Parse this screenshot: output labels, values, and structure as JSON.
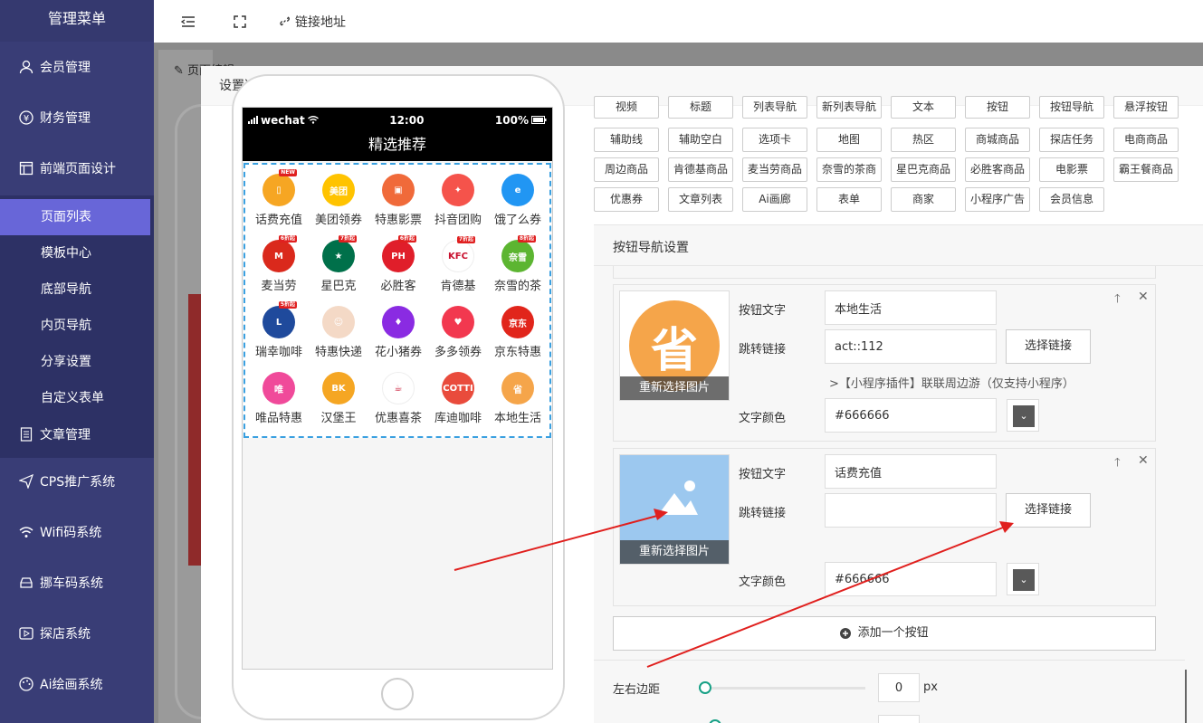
{
  "sidebar": {
    "title": "管理菜单",
    "items": [
      {
        "label": "会员管理",
        "icon": "user-icon"
      },
      {
        "label": "财务管理",
        "icon": "yen-icon"
      },
      {
        "label": "前端页面设计",
        "icon": "layout-icon"
      },
      {
        "label": "文章管理",
        "icon": "document-icon"
      },
      {
        "label": "CPS推广系统",
        "icon": "send-icon"
      },
      {
        "label": "Wifi码系统",
        "icon": "wifi-icon"
      },
      {
        "label": "挪车码系统",
        "icon": "car-icon"
      },
      {
        "label": "探店系统",
        "icon": "video-icon"
      },
      {
        "label": "Ai绘画系统",
        "icon": "palette-icon"
      }
    ],
    "sub_items": [
      "页面列表",
      "模板中心",
      "底部导航",
      "内页导航",
      "分享设置",
      "自定义表单"
    ]
  },
  "topbar": {
    "link_label": "链接地址"
  },
  "background": {
    "edit_label": "页面编辑"
  },
  "modal": {
    "title": "设置选项卡内容"
  },
  "phone": {
    "carrier": "wechat",
    "time": "12:00",
    "battery": "100%",
    "title": "精选推荐",
    "grid": [
      {
        "label": "话费充值",
        "color": "#f6a623",
        "glyph": "▯",
        "tag": "NEW"
      },
      {
        "label": "美团领券",
        "color": "#ffc300",
        "glyph": "美团",
        "tag": ""
      },
      {
        "label": "特惠影票",
        "color": "#f06a3a",
        "glyph": "▣",
        "tag": ""
      },
      {
        "label": "抖音团购",
        "color": "#f5534b",
        "glyph": "✦",
        "tag": ""
      },
      {
        "label": "饿了么券",
        "color": "#2196f3",
        "glyph": "e",
        "tag": ""
      },
      {
        "label": "麦当劳",
        "color": "#da291c",
        "glyph": "M",
        "tag": "6折起"
      },
      {
        "label": "星巴克",
        "color": "#00704a",
        "glyph": "★",
        "tag": "7折起"
      },
      {
        "label": "必胜客",
        "color": "#e01e2a",
        "glyph": "PH",
        "tag": "6折起"
      },
      {
        "label": "肯德基",
        "color": "#ffffff",
        "glyph": "KFC",
        "tag": "7折起"
      },
      {
        "label": "奈雪的茶",
        "color": "#5cb531",
        "glyph": "奈雪",
        "tag": "8折起"
      },
      {
        "label": "瑞幸咖啡",
        "color": "#1f4a9c",
        "glyph": "L",
        "tag": "5折起"
      },
      {
        "label": "特惠快递",
        "color": "#f4d9c6",
        "glyph": "☺",
        "tag": ""
      },
      {
        "label": "花小猪券",
        "color": "#8a2be2",
        "glyph": "♦",
        "tag": ""
      },
      {
        "label": "多多领券",
        "color": "#f2384f",
        "glyph": "♥",
        "tag": ""
      },
      {
        "label": "京东特惠",
        "color": "#e1251b",
        "glyph": "京东",
        "tag": ""
      },
      {
        "label": "唯品特惠",
        "color": "#f04a9a",
        "glyph": "唯",
        "tag": ""
      },
      {
        "label": "汉堡王",
        "color": "#f5a623",
        "glyph": "BK",
        "tag": ""
      },
      {
        "label": "优惠喜茶",
        "color": "#ffffff",
        "glyph": "☕",
        "tag": ""
      },
      {
        "label": "库迪咖啡",
        "color": "#e94b3c",
        "glyph": "COTTI",
        "tag": ""
      },
      {
        "label": "本地生活",
        "color": "#f5a54a",
        "glyph": "省",
        "tag": ""
      }
    ]
  },
  "components": {
    "row1": [
      "视频",
      "标题",
      "列表导航",
      "新列表导航",
      "文本",
      "按钮",
      "按钮导航",
      "悬浮按钮"
    ],
    "row2": [
      "辅助线",
      "辅助空白",
      "选项卡",
      "地图",
      "热区",
      "商城商品",
      "探店任务",
      "电商商品"
    ],
    "row3": [
      "周边商品",
      "肯德基商品",
      "麦当劳商品",
      "奈雪的茶商",
      "星巴克商品",
      "必胜客商品",
      "电影票",
      "霸王餐商品"
    ],
    "row4": [
      "优惠券",
      "文章列表",
      "Ai画廊",
      "表单",
      "商家",
      "小程序广告",
      "会员信息"
    ]
  },
  "settings": {
    "header": "按钮导航设置",
    "cards": [
      {
        "reselect_label": "重新选择图片",
        "text_label": "按钮文字",
        "text_value": "本地生活",
        "link_label": "跳转链接",
        "link_value": "act::112",
        "select_link_label": "选择链接",
        "link_hint": ">【小程序插件】联联周边游（仅支持小程序）",
        "color_label": "文字颜色",
        "color_value": "#666666"
      },
      {
        "reselect_label": "重新选择图片",
        "text_label": "按钮文字",
        "text_value": "话费充值",
        "link_label": "跳转链接",
        "link_value": "",
        "select_link_label": "选择链接",
        "color_label": "文字颜色",
        "color_value": "#666666"
      }
    ],
    "add_button_label": "添加一个按钮",
    "margin_label": "左右边距",
    "margin_value": "0",
    "margin_unit": "px"
  }
}
